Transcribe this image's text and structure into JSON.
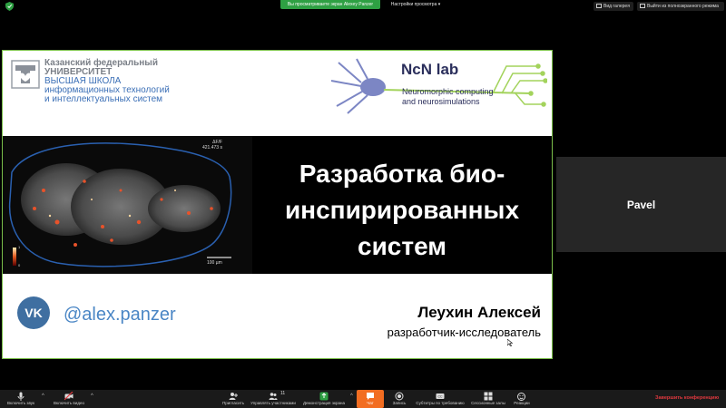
{
  "top_bar": {
    "share_banner": "Вы просматриваете экран Alexey Panzer",
    "view_options": "Настройки просмотра",
    "gallery_label": "Вид галерея",
    "exit_fullscreen_label": "Выйти из полноэкранного режима"
  },
  "slide": {
    "kfu": {
      "line1": "Казанский федеральный",
      "line2": "УНИВЕРСИТЕТ",
      "line3": "ВЫСШАЯ ШКОЛА",
      "line4": "информационных технологий",
      "line5": "и интеллектуальных систем"
    },
    "ncn": {
      "title": "NcN lab",
      "sub1": "Neuromorphic computing",
      "sub2": "and neurosimulations"
    },
    "brain": {
      "timestamp_line1": "ΔF/F",
      "timestamp_line2": "421.473 s",
      "scale": "100 µm",
      "colorbar_max": "1",
      "colorbar_min": "0"
    },
    "title_line1": "Разработка био-",
    "title_line2": "инспирированных",
    "title_line3": "систем",
    "vk_icon": "vk-icon",
    "vk_handle": "@alex.panzer",
    "author_name": "Леухин Алексей",
    "author_role": "разработчик-исследователь"
  },
  "participant": {
    "name": "Pavel"
  },
  "toolbar": {
    "unmute": "Включить звук",
    "video": "Включить видео",
    "invite": "Пригласить",
    "participants": "Управлять участниками",
    "participants_count": "11",
    "share": "Демонстрация экрана",
    "chat": "Чат",
    "record": "Запись",
    "subtitles": "Субтитры по требованию",
    "breakout": "Сессионные залы",
    "reactions": "Реакции",
    "end": "Завершить конференцию"
  },
  "colors": {
    "accent_green": "#2ea043",
    "chat_orange": "#f26d21",
    "end_red": "#e0383e",
    "kfu_blue": "#3b6fb6",
    "vk_blue": "#3f6fa1"
  }
}
